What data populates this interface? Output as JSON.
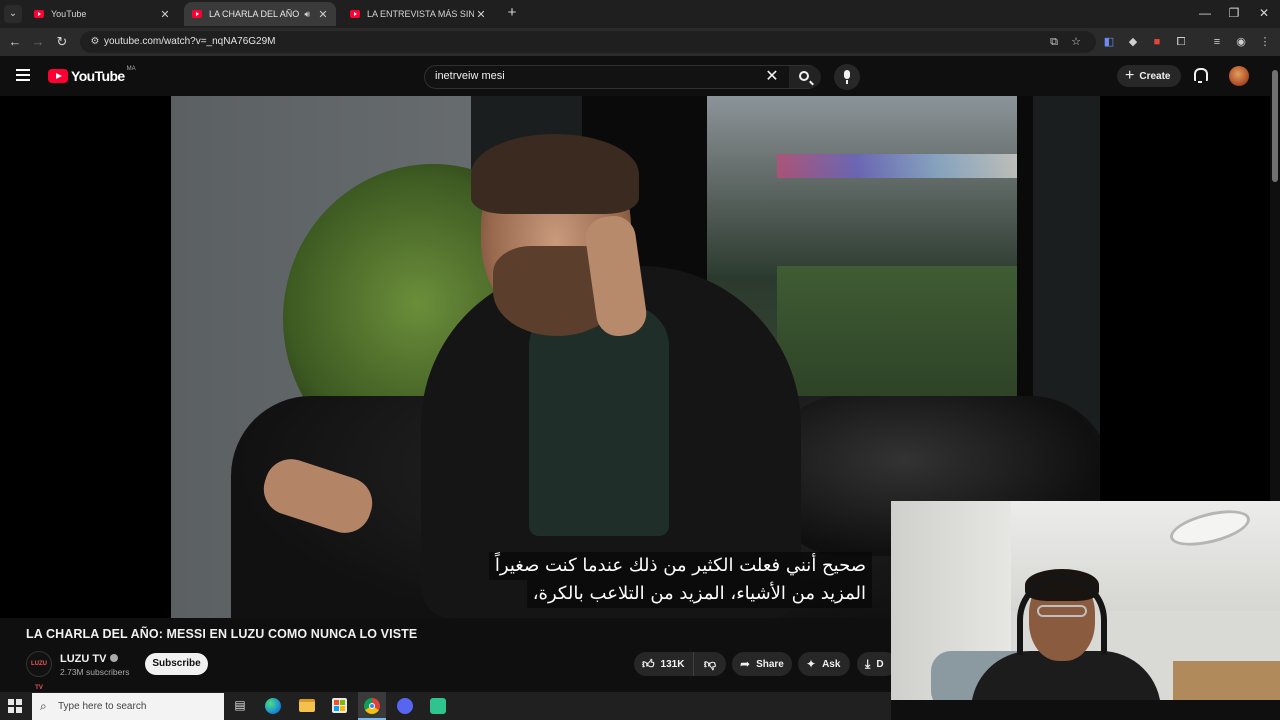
{
  "browser": {
    "tabs": [
      {
        "title": "YouTube",
        "active": false,
        "muted": false
      },
      {
        "title": "LA CHARLA DEL AÑO: MES",
        "active": true,
        "muted": true
      },
      {
        "title": "LA ENTREVISTA MÁS SINCERA",
        "active": false,
        "muted": false
      }
    ],
    "url": "youtube.com/watch?v=_nqNA76G29M"
  },
  "youtube": {
    "logo_text": "YouTube",
    "country_code": "MA",
    "search_value": "inetrveiw mesi",
    "create_label": "Create"
  },
  "video": {
    "subtitle_lines": [
      "صحيح أنني فعلت الكثير من ذلك عندما كنت صغيراً",
      "المزيد من الأشياء، المزيد من التلاعب بالكرة،"
    ],
    "title": "LA CHARLA DEL AÑO: MESSI EN LUZU COMO NUNCA LO VISTE",
    "channel": {
      "avatar_text": "LUZU TV",
      "name": "LUZU TV",
      "subscribers": "2.73M subscribers",
      "subscribe_label": "Subscribe"
    },
    "actions": {
      "likes": "131K",
      "share_label": "Share",
      "ask_label": "Ask",
      "download_label": "D"
    }
  },
  "taskbar": {
    "search_placeholder": "Type here to search"
  },
  "colors": {
    "yt_red": "#ff0033",
    "background": "#0f0f0f",
    "pill": "#272727"
  }
}
